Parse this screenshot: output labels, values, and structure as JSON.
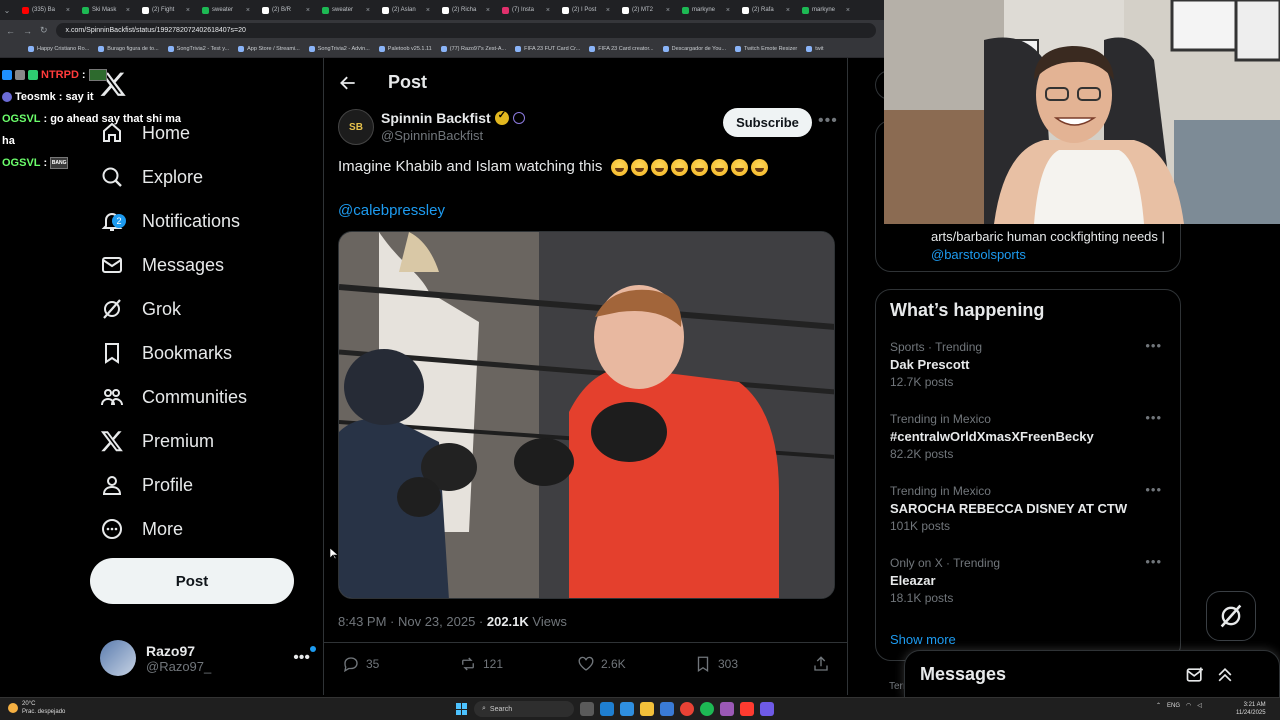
{
  "browser": {
    "tabs": [
      {
        "label": "(335) Ba",
        "color": "#ff0000"
      },
      {
        "label": "Ski Mask",
        "color": "#1db954"
      },
      {
        "label": "(2) Fight",
        "color": "#ffffff"
      },
      {
        "label": "sweater",
        "color": "#1db954"
      },
      {
        "label": "(2) B/R",
        "color": "#ffffff"
      },
      {
        "label": "sweater",
        "color": "#1db954"
      },
      {
        "label": "(2) Aslan",
        "color": "#ffffff"
      },
      {
        "label": "(2) Richa",
        "color": "#ffffff"
      },
      {
        "label": "(7) Insta",
        "color": "#e1306c"
      },
      {
        "label": "(2) I Post",
        "color": "#ffffff"
      },
      {
        "label": "(2) MT2",
        "color": "#ffffff"
      },
      {
        "label": "markyne",
        "color": "#1db954"
      },
      {
        "label": "(2) Rafa",
        "color": "#ffffff"
      },
      {
        "label": "markyne",
        "color": "#1db954"
      }
    ],
    "url": "x.com/SpinninBackfist/status/1992782072402618407s=20",
    "bookmarks": [
      "Happy Cristiano Ro...",
      "Burago figura de to...",
      "SongTrivia2 - Test y...",
      "App Store / Streami...",
      "SongTrivia2 - Advin...",
      "Paletoob v25.1.11",
      "(77) Razo97's Zest-A...",
      "FIFA 23 FUT Card Cr...",
      "FIFA 23 Card creator...",
      "Descargador de You...",
      "Twitch Emote Resizer",
      "twit"
    ]
  },
  "chat": [
    {
      "user": "NTRPD",
      "message": ""
    },
    {
      "user": "Teosmk",
      "message": "say it"
    },
    {
      "user": "OGSVL",
      "message": "go ahead say that shi ma"
    },
    {
      "user": "",
      "message": "ha"
    },
    {
      "user": "OGSVL",
      "message": ""
    }
  ],
  "nav": {
    "items": [
      {
        "label": "Home",
        "icon": "home-icon"
      },
      {
        "label": "Explore",
        "icon": "search-icon"
      },
      {
        "label": "Notifications",
        "icon": "bell-icon",
        "badge": "2"
      },
      {
        "label": "Messages",
        "icon": "mail-icon"
      },
      {
        "label": "Grok",
        "icon": "grok-icon"
      },
      {
        "label": "Bookmarks",
        "icon": "bookmark-icon"
      },
      {
        "label": "Communities",
        "icon": "communities-icon"
      },
      {
        "label": "Premium",
        "icon": "x-logo-icon"
      },
      {
        "label": "Profile",
        "icon": "person-icon"
      },
      {
        "label": "More",
        "icon": "more-circle-icon"
      }
    ],
    "post_button": "Post",
    "account": {
      "name": "Razo97",
      "handle": "@Razo97_"
    }
  },
  "post": {
    "header_title": "Post",
    "author_name": "Spinnin Backfist",
    "author_handle": "@SpinninBackfist",
    "avatar_text": "SB",
    "subscribe_label": "Subscribe",
    "text": "Imagine Khabib and Islam watching this",
    "emoji_count": 8,
    "mention": "@calebpressley",
    "timestamp": "8:43 PM · Nov 23, 2025 · ",
    "views_count": "202.1K",
    "views_label": " Views",
    "replies": "35",
    "reposts": "121",
    "likes": "2.6K",
    "bookmarks": "303"
  },
  "sidebar": {
    "bio_text": "arts/barbaric human cockfighting needs | ",
    "bio_link": "@barstoolsports",
    "trends_title": "What’s happening",
    "trends": [
      {
        "context": "Sports · Trending",
        "name": "Dak Prescott",
        "count": "12.7K posts"
      },
      {
        "context": "Trending in Mexico",
        "name": "#centralwOrldXmasXFreenBecky",
        "count": "82.2K posts"
      },
      {
        "context": "Trending in Mexico",
        "name": "SAROCHA REBECCA DISNEY AT CTW",
        "count": "101K posts"
      },
      {
        "context": "Only on X · Trending",
        "name": "Eleazar",
        "count": "18.1K posts"
      }
    ],
    "show_more": "Show more",
    "footer_peek": "Terı"
  },
  "messages_drawer": {
    "title": "Messages"
  },
  "taskbar": {
    "weather_temp": "20°C",
    "weather_desc": "Prac. despejado",
    "search_label": "Search",
    "lang": "ENG",
    "time": "3:21 AM",
    "date": "11/24/2025"
  },
  "colors": {
    "accent": "#1d9bf0",
    "background": "#000000",
    "text": "#e7e9ea",
    "muted": "#71767b",
    "border": "#2f3336"
  }
}
